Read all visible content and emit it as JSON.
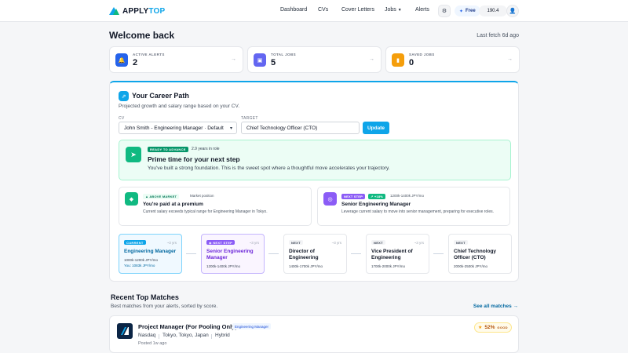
{
  "nav": {
    "logo_part1": "APPLY",
    "logo_part2": "TOP",
    "links": [
      "Dashboard",
      "CVs",
      "Cover Letters",
      "Jobs",
      "Alerts"
    ],
    "plan": "Free",
    "credits": "190.4"
  },
  "header": {
    "title": "Welcome back",
    "last_fetch": "Last fetch 6d ago"
  },
  "stats": [
    {
      "label": "ACTIVE ALERTS",
      "value": "2",
      "color": "#2563eb",
      "icon": "bell-icon"
    },
    {
      "label": "TOTAL JOBS",
      "value": "5",
      "color": "#6366f1",
      "icon": "briefcase-icon"
    },
    {
      "label": "SAVED JOBS",
      "value": "0",
      "color": "#f59e0b",
      "icon": "bookmark-icon"
    }
  ],
  "career": {
    "title": "Your Career Path",
    "subtitle": "Projected growth and salary range based on your CV.",
    "cv_label": "CV",
    "cv_value": "John Smith - Engineering Manager · Default",
    "target_label": "TARGET",
    "target_value": "Chief Technology Officer (CTO)",
    "update_label": "Update",
    "ready": {
      "badge": "READY TO ADVANCE",
      "meta": "2.9 years in role",
      "title": "Prime time for your next step",
      "body": "You've built a strong foundation. This is the sweet spot where a thoughtful move accelerates your trajectory."
    },
    "market": {
      "badge": "▲ ABOVE MARKET",
      "meta": "Market position",
      "title": "You're paid at a premium",
      "body": "Current salary exceeds typical range for Engineering Manager in Tokyo."
    },
    "next": {
      "badge": "NEXT STEP",
      "delta": "↗ +18%",
      "range": "1200k-1400k JPY/mo",
      "title": "Senior Engineering Manager",
      "body": "Leverage current salary to move into senior management, preparing for executive roles."
    },
    "steps": [
      {
        "tag": "CURRENT",
        "yrs": "~3 yrs",
        "title": "Engineering Manager",
        "range": "1000k-1200k JPY/mo",
        "you": "You: 1083k JPY/mo"
      },
      {
        "tag": "◉ NEXT STEP",
        "yrs": "~3 yrs",
        "title": "Senior Engineering Manager",
        "range": "1200k-1400k JPY/mo"
      },
      {
        "tag": "NEXT",
        "yrs": "~3 yrs",
        "title": "Director of Engineering",
        "range": "1400k-1700k JPY/mo"
      },
      {
        "tag": "NEXT",
        "yrs": "~3 yrs",
        "title": "Vice President of Engineering",
        "range": "1700k-2000k JPY/mo"
      },
      {
        "tag": "NEXT",
        "yrs": "",
        "title": "Chief Technology Officer (CTO)",
        "range": "2000k-2500k JPY/mo"
      }
    ]
  },
  "matches": {
    "title": "Recent Top Matches",
    "subtitle": "Best matches from your alerts, sorted by score.",
    "see_all": "See all matches →",
    "job": {
      "title": "Project Manager (For Pooling Only)",
      "tag": "Engineering Manager",
      "company": "Nasdaq",
      "location": "Tokyo, Tokyo, Japan",
      "mode": "Hybrid",
      "posted": "Posted 1w ago",
      "score": "52%",
      "score_label": "GOOD"
    }
  }
}
